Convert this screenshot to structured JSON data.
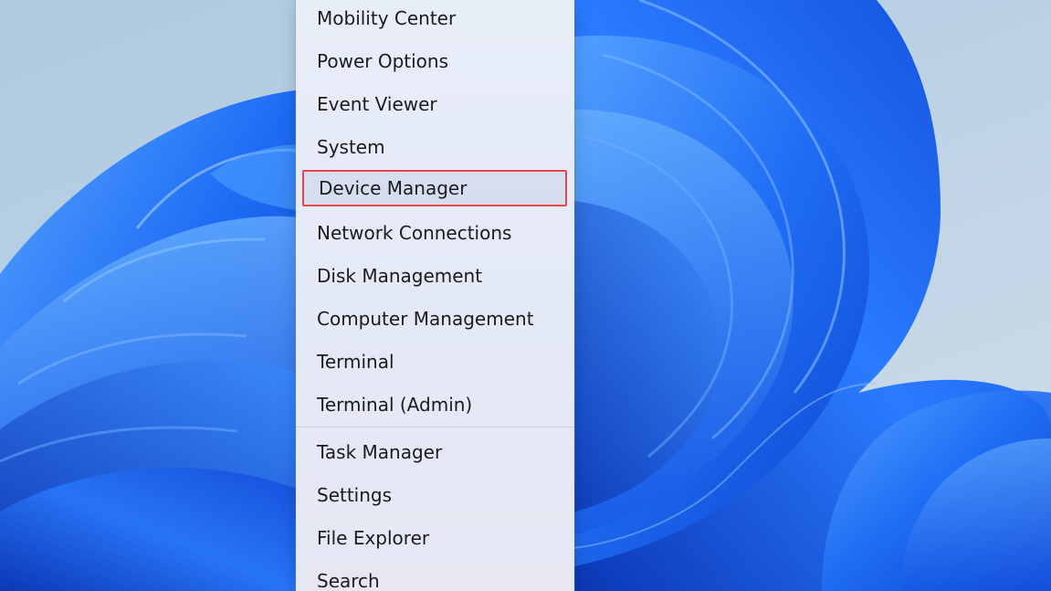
{
  "menu": {
    "group_primary": [
      {
        "label": "Mobility Center"
      },
      {
        "label": "Power Options"
      },
      {
        "label": "Event Viewer"
      },
      {
        "label": "System"
      },
      {
        "label": "Device Manager",
        "highlighted": true
      },
      {
        "label": "Network Connections"
      },
      {
        "label": "Disk Management"
      },
      {
        "label": "Computer Management"
      },
      {
        "label": "Terminal"
      },
      {
        "label": "Terminal (Admin)"
      }
    ],
    "group_secondary": [
      {
        "label": "Task Manager"
      },
      {
        "label": "Settings"
      },
      {
        "label": "File Explorer"
      },
      {
        "label": "Search"
      }
    ]
  },
  "colors": {
    "highlight_border": "#e8474a",
    "wallpaper_blue": "#1c5ff0",
    "background": "#b9d0e4"
  }
}
